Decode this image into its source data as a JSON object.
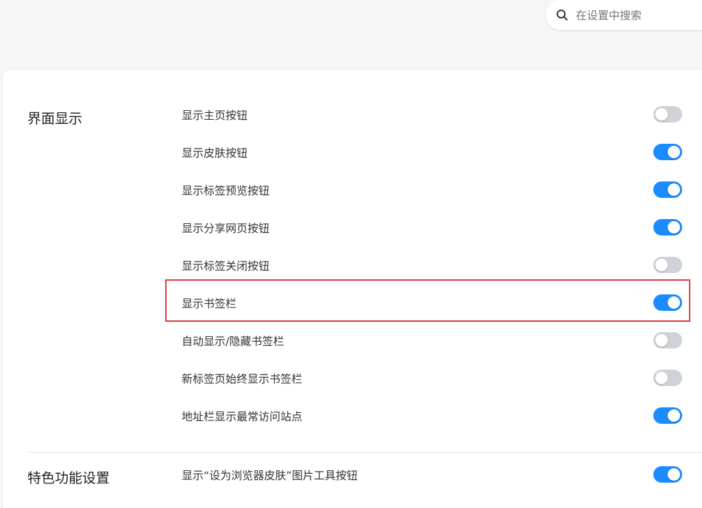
{
  "search": {
    "placeholder": "在设置中搜索"
  },
  "sections": [
    {
      "title": "界面显示",
      "items": [
        {
          "label": "显示主页按钮",
          "enabled": false
        },
        {
          "label": "显示皮肤按钮",
          "enabled": true
        },
        {
          "label": "显示标签预览按钮",
          "enabled": true
        },
        {
          "label": "显示分享网页按钮",
          "enabled": true
        },
        {
          "label": "显示标签关闭按钮",
          "enabled": false
        },
        {
          "label": "显示书签栏",
          "enabled": true,
          "highlighted": true
        },
        {
          "label": "自动显示/隐藏书签栏",
          "enabled": false
        },
        {
          "label": "新标签页始终显示书签栏",
          "enabled": false
        },
        {
          "label": "地址栏显示最常访问站点",
          "enabled": true
        }
      ]
    },
    {
      "title": "特色功能设置",
      "items": [
        {
          "label": "显示“设为浏览器皮肤”图片工具按钮",
          "enabled": true
        }
      ]
    }
  ],
  "colors": {
    "toggle_on": "#1a8cff",
    "toggle_off": "#cfd2d6",
    "highlight": "#e23333"
  }
}
